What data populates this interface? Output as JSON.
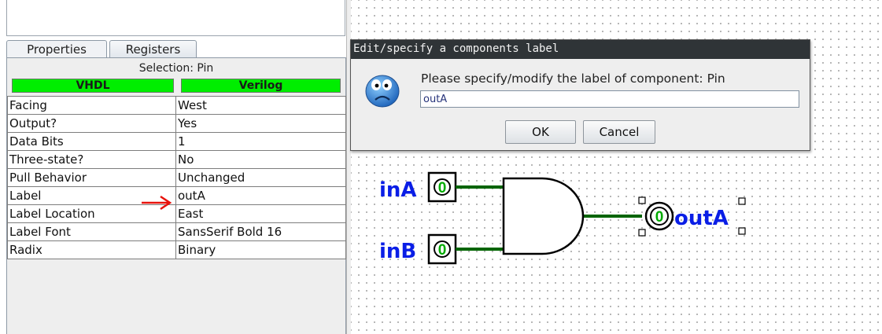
{
  "tabs": [
    {
      "label": "Properties",
      "active": true
    },
    {
      "label": "Registers",
      "active": false
    }
  ],
  "selection_title": "Selection: Pin",
  "hdl_buttons": {
    "vhdl": "VHDL",
    "verilog": "Verilog",
    "color": "#00ee00"
  },
  "properties": [
    {
      "key": "Facing",
      "value": "West"
    },
    {
      "key": "Output?",
      "value": "Yes"
    },
    {
      "key": "Data Bits",
      "value": "1"
    },
    {
      "key": "Three-state?",
      "value": "No"
    },
    {
      "key": "Pull Behavior",
      "value": "Unchanged"
    },
    {
      "key": "Label",
      "value": "outA"
    },
    {
      "key": "Label Location",
      "value": "East"
    },
    {
      "key": "Label Font",
      "value": "SansSerif Bold 16"
    },
    {
      "key": "Radix",
      "value": "Binary"
    }
  ],
  "annotation_arrow": {
    "icon": "red-arrow-icon",
    "color": "#e8120c"
  },
  "dialog": {
    "title": "Edit/specify a components label",
    "message": "Please specify/modify the label of component: Pin",
    "input_value": "outA",
    "ok_label": "OK",
    "cancel_label": "Cancel",
    "icon": "worried-face-icon"
  },
  "circuit": {
    "input_a": {
      "label": "inA",
      "value": "0"
    },
    "input_b": {
      "label": "inB",
      "value": "0"
    },
    "output": {
      "label": "outA",
      "value": "0"
    },
    "gate": "and-gate",
    "label_color": "#0a1ee6",
    "wire_color": "#006400",
    "pin_value_color": "#00aa00"
  }
}
